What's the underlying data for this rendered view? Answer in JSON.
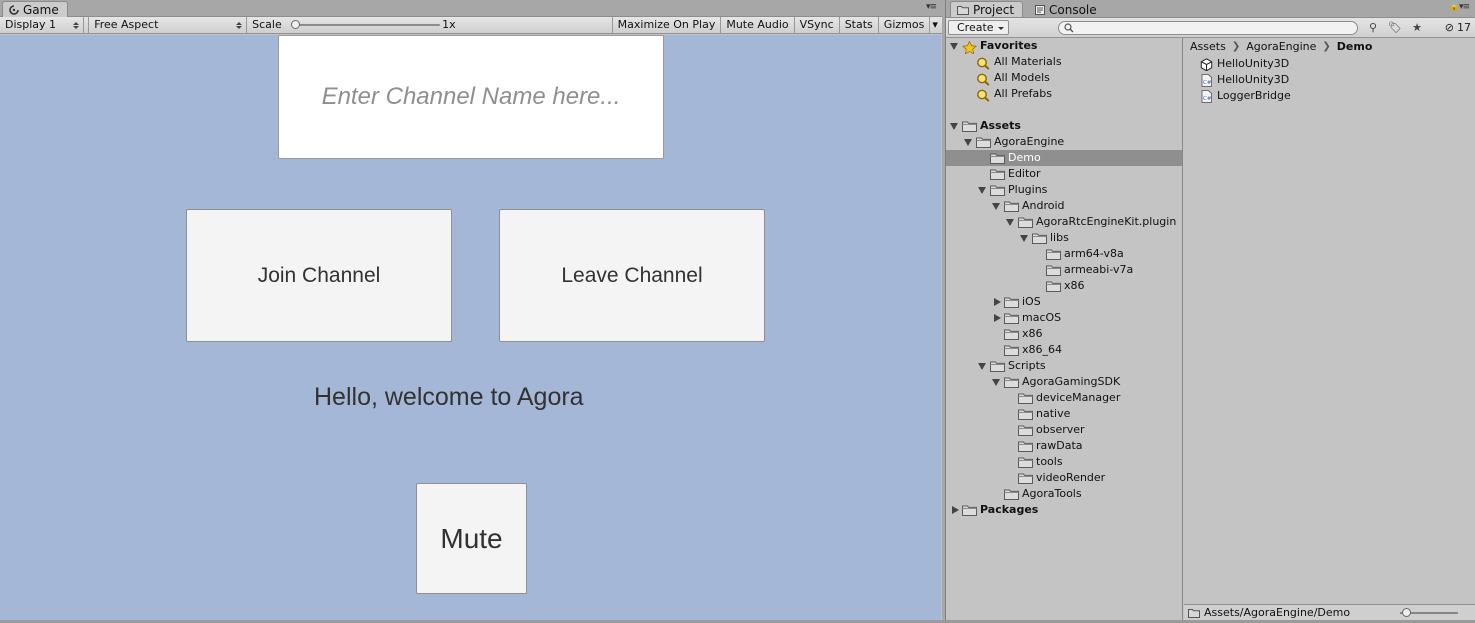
{
  "game": {
    "tab_label": "Game",
    "toolbar": {
      "display": "Display 1",
      "aspect": "Free Aspect",
      "scale_label": "Scale",
      "scale_value": "1x",
      "scale_fraction": 0.0,
      "maximize": "Maximize On Play",
      "mute_audio": "Mute Audio",
      "vsync": "VSync",
      "stats": "Stats",
      "gizmos": "Gizmos"
    },
    "viewport": {
      "channel_placeholder": "Enter Channel Name here...",
      "join_button": "Join Channel",
      "leave_button": "Leave Channel",
      "welcome_text": "Hello, welcome to Agora",
      "mute_button": "Mute"
    }
  },
  "project": {
    "tabs": [
      "Project",
      "Console"
    ],
    "create_label": "Create",
    "search_placeholder": "",
    "hidden_count": "17",
    "tree": [
      {
        "label": "Favorites",
        "depth": 0,
        "expander": "down",
        "icon": "star-icon",
        "bold": true
      },
      {
        "label": "All Materials",
        "depth": 1,
        "expander": "none",
        "icon": "search-icon"
      },
      {
        "label": "All Models",
        "depth": 1,
        "expander": "none",
        "icon": "search-icon"
      },
      {
        "label": "All Prefabs",
        "depth": 1,
        "expander": "none",
        "icon": "search-icon"
      },
      {
        "label": "",
        "depth": 0,
        "expander": "spacer",
        "icon": "none"
      },
      {
        "label": "Assets",
        "depth": 0,
        "expander": "down",
        "icon": "folder-icon",
        "bold": true
      },
      {
        "label": "AgoraEngine",
        "depth": 1,
        "expander": "down",
        "icon": "folder-icon"
      },
      {
        "label": "Demo",
        "depth": 2,
        "expander": "none",
        "icon": "folder-icon",
        "selected": true
      },
      {
        "label": "Editor",
        "depth": 2,
        "expander": "none",
        "icon": "folder-icon"
      },
      {
        "label": "Plugins",
        "depth": 2,
        "expander": "down",
        "icon": "folder-icon"
      },
      {
        "label": "Android",
        "depth": 3,
        "expander": "down",
        "icon": "folder-icon"
      },
      {
        "label": "AgoraRtcEngineKit.plugin",
        "depth": 4,
        "expander": "down",
        "icon": "folder-icon"
      },
      {
        "label": "libs",
        "depth": 5,
        "expander": "down",
        "icon": "folder-icon"
      },
      {
        "label": "arm64-v8a",
        "depth": 6,
        "expander": "none",
        "icon": "folder-icon"
      },
      {
        "label": "armeabi-v7a",
        "depth": 6,
        "expander": "none",
        "icon": "folder-icon"
      },
      {
        "label": "x86",
        "depth": 6,
        "expander": "none",
        "icon": "folder-icon"
      },
      {
        "label": "iOS",
        "depth": 3,
        "expander": "right",
        "icon": "folder-icon"
      },
      {
        "label": "macOS",
        "depth": 3,
        "expander": "right",
        "icon": "folder-icon"
      },
      {
        "label": "x86",
        "depth": 3,
        "expander": "none",
        "icon": "folder-icon"
      },
      {
        "label": "x86_64",
        "depth": 3,
        "expander": "none",
        "icon": "folder-icon"
      },
      {
        "label": "Scripts",
        "depth": 2,
        "expander": "down",
        "icon": "folder-icon"
      },
      {
        "label": "AgoraGamingSDK",
        "depth": 3,
        "expander": "down",
        "icon": "folder-icon"
      },
      {
        "label": "deviceManager",
        "depth": 4,
        "expander": "none",
        "icon": "folder-icon"
      },
      {
        "label": "native",
        "depth": 4,
        "expander": "none",
        "icon": "folder-icon"
      },
      {
        "label": "observer",
        "depth": 4,
        "expander": "none",
        "icon": "folder-icon"
      },
      {
        "label": "rawData",
        "depth": 4,
        "expander": "none",
        "icon": "folder-icon"
      },
      {
        "label": "tools",
        "depth": 4,
        "expander": "none",
        "icon": "folder-icon"
      },
      {
        "label": "videoRender",
        "depth": 4,
        "expander": "none",
        "icon": "folder-icon"
      },
      {
        "label": "AgoraTools",
        "depth": 3,
        "expander": "none",
        "icon": "folder-icon"
      },
      {
        "label": "Packages",
        "depth": 0,
        "expander": "right",
        "icon": "folder-icon",
        "bold": true
      }
    ],
    "breadcrumb": [
      "Assets",
      "AgoraEngine",
      "Demo"
    ],
    "files": [
      {
        "label": "HelloUnity3D",
        "icon": "unity-scene-icon"
      },
      {
        "label": "HelloUnity3D",
        "icon": "csharp-script-icon"
      },
      {
        "label": "LoggerBridge",
        "icon": "csharp-script-icon"
      }
    ],
    "status_path": "Assets/AgoraEngine/Demo"
  },
  "colors": {
    "viewport_bg": "#a5b7d7",
    "editor_bg": "#c2c2c2",
    "selection": "#8f8f8f"
  }
}
